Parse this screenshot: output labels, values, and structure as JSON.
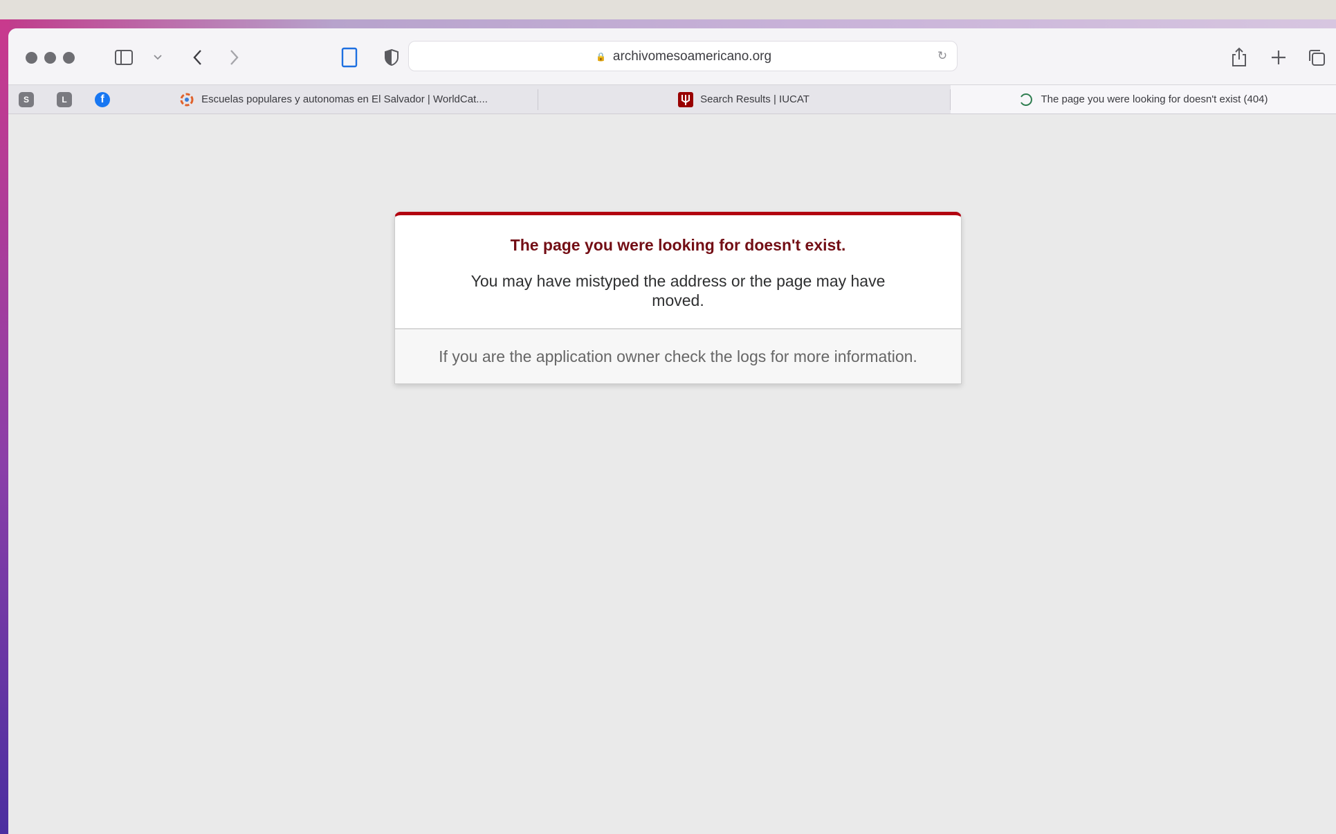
{
  "browser": {
    "address_bar": {
      "domain": "archivomesoamericano.org"
    },
    "pinned_tabs": [
      {
        "label": "S",
        "color": "#7a7a80"
      },
      {
        "label": "L",
        "color": "#7a7a80"
      },
      {
        "label": "f",
        "color": "#1877f2"
      }
    ],
    "tabs": [
      {
        "title": "Escuelas populares y autonomas en El Salvador | WorldCat....",
        "active": false
      },
      {
        "title": "Search Results | IUCAT",
        "active": false
      },
      {
        "title": "The page you were looking for doesn't exist (404)",
        "active": true
      }
    ]
  },
  "error_page": {
    "title": "The page you were looking for doesn't exist.",
    "message": "You may have mistyped the address or the page may have moved.",
    "footer": "If you are the application owner check the logs for more information.",
    "accent_color": "#b2010f",
    "title_color": "#730e15"
  }
}
